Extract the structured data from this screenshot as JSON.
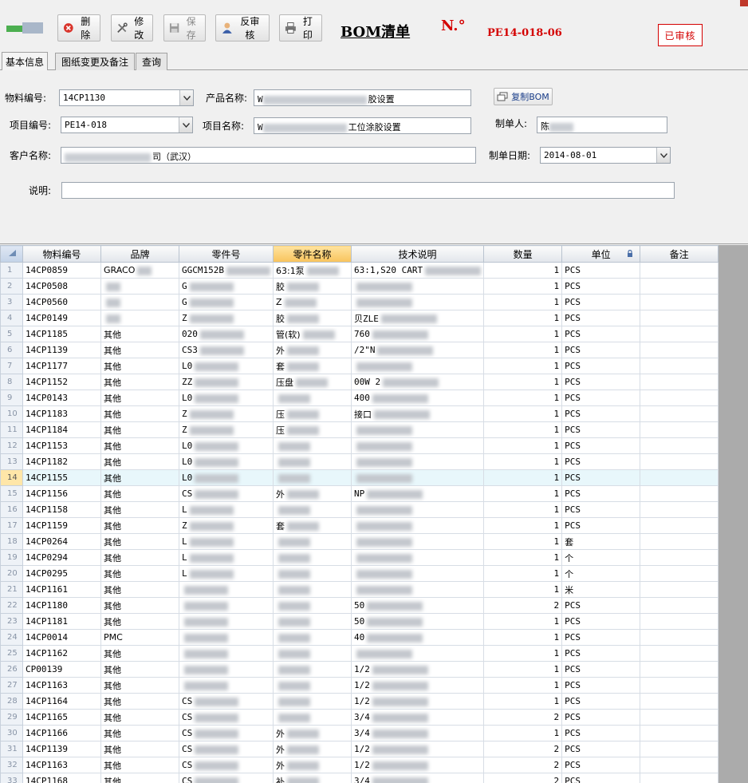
{
  "toolbar": {
    "delete_label": "删除",
    "edit_label": "修改",
    "save_label": "保存",
    "unaudit_label": "反审核",
    "print_label": "打印"
  },
  "header": {
    "title": "BOM清单",
    "no_label": "N.°",
    "no_value": "PE14-018-06",
    "stamp": "已审核"
  },
  "tabs": [
    "基本信息",
    "图纸变更及备注",
    "查询"
  ],
  "form": {
    "material_no_label": "物料编号:",
    "material_no_value": "14CP1130",
    "product_name_label": "产品名称:",
    "product_name_prefix": "W",
    "product_name_suffix": "胶设置",
    "copy_bom_label": "复制BOM",
    "project_no_label": "项目编号:",
    "project_no_value": "PE14-018",
    "project_name_label": "项目名称:",
    "project_name_prefix": "W",
    "project_name_suffix": "工位涂胶设置",
    "maker_label": "制单人:",
    "maker_value": "陈",
    "customer_label": "客户名称:",
    "customer_suffix": "司（武汉）",
    "date_label": "制单日期:",
    "date_value": "2014-08-01",
    "remark_label": "说明:"
  },
  "grid": {
    "columns": [
      "物料编号",
      "品牌",
      "零件号",
      "零件名称",
      "技术说明",
      "数量",
      "单位",
      "备注"
    ],
    "rows": [
      {
        "n": "1",
        "code": "14CP0859",
        "brand": "GRACO",
        "part": "GGCM152B",
        "name": "63:1泵",
        "tech": "63:1,S20 CART",
        "qty": "1",
        "unit": "PCS"
      },
      {
        "n": "2",
        "code": "14CP0508",
        "brand": "",
        "part": "G",
        "name": "胶",
        "tech": "",
        "qty": "1",
        "unit": "PCS"
      },
      {
        "n": "3",
        "code": "14CP0560",
        "brand": "",
        "part": "G",
        "name": "Z",
        "tech": "",
        "qty": "1",
        "unit": "PCS"
      },
      {
        "n": "4",
        "code": "14CP0149",
        "brand": "",
        "part": "Z",
        "name": "胶",
        "tech": "贝ZLE",
        "qty": "1",
        "unit": "PCS"
      },
      {
        "n": "5",
        "code": "14CP1185",
        "brand": "其他",
        "part": "020",
        "name": "管(软)",
        "tech": "760",
        "qty": "1",
        "unit": "PCS"
      },
      {
        "n": "6",
        "code": "14CP1139",
        "brand": "其他",
        "part": "CS3",
        "name": "外",
        "tech": "/2\"N",
        "qty": "1",
        "unit": "PCS"
      },
      {
        "n": "7",
        "code": "14CP1177",
        "brand": "其他",
        "part": "L0",
        "name": "套",
        "tech": "",
        "qty": "1",
        "unit": "PCS"
      },
      {
        "n": "8",
        "code": "14CP1152",
        "brand": "其他",
        "part": "ZZ",
        "name": "压盘",
        "tech": "00W 2",
        "qty": "1",
        "unit": "PCS"
      },
      {
        "n": "9",
        "code": "14CP0143",
        "brand": "其他",
        "part": "L0",
        "name": "",
        "tech": "400",
        "qty": "1",
        "unit": "PCS"
      },
      {
        "n": "10",
        "code": "14CP1183",
        "brand": "其他",
        "part": "Z",
        "name": "压",
        "tech": "接口",
        "qty": "1",
        "unit": "PCS"
      },
      {
        "n": "11",
        "code": "14CP1184",
        "brand": "其他",
        "part": "Z",
        "name": "压",
        "tech": "",
        "qty": "1",
        "unit": "PCS"
      },
      {
        "n": "12",
        "code": "14CP1153",
        "brand": "其他",
        "part": "L0",
        "name": "",
        "tech": "",
        "qty": "1",
        "unit": "PCS"
      },
      {
        "n": "13",
        "code": "14CP1182",
        "brand": "其他",
        "part": "L0",
        "name": "",
        "tech": "",
        "qty": "1",
        "unit": "PCS"
      },
      {
        "n": "14",
        "code": "14CP1155",
        "brand": "其他",
        "part": "L0",
        "name": "",
        "tech": "",
        "qty": "1",
        "unit": "PCS"
      },
      {
        "n": "15",
        "code": "14CP1156",
        "brand": "其他",
        "part": "CS",
        "name": "外",
        "tech": "NP",
        "qty": "1",
        "unit": "PCS"
      },
      {
        "n": "16",
        "code": "14CP1158",
        "brand": "其他",
        "part": "L",
        "name": "",
        "tech": "",
        "qty": "1",
        "unit": "PCS"
      },
      {
        "n": "17",
        "code": "14CP1159",
        "brand": "其他",
        "part": "Z",
        "name": "套",
        "tech": "",
        "qty": "1",
        "unit": "PCS"
      },
      {
        "n": "18",
        "code": "14CP0264",
        "brand": "其他",
        "part": "L",
        "name": "",
        "tech": "",
        "qty": "1",
        "unit": "套"
      },
      {
        "n": "19",
        "code": "14CP0294",
        "brand": "其他",
        "part": "L",
        "name": "",
        "tech": "",
        "qty": "1",
        "unit": "个"
      },
      {
        "n": "20",
        "code": "14CP0295",
        "brand": "其他",
        "part": "L",
        "name": "",
        "tech": "",
        "qty": "1",
        "unit": "个"
      },
      {
        "n": "21",
        "code": "14CP1161",
        "brand": "其他",
        "part": "",
        "name": "",
        "tech": "",
        "qty": "1",
        "unit": "米"
      },
      {
        "n": "22",
        "code": "14CP1180",
        "brand": "其他",
        "part": "",
        "name": "",
        "tech": "50",
        "qty": "2",
        "unit": "PCS"
      },
      {
        "n": "23",
        "code": "14CP1181",
        "brand": "其他",
        "part": "",
        "name": "",
        "tech": "50",
        "qty": "1",
        "unit": "PCS"
      },
      {
        "n": "24",
        "code": "14CP0014",
        "brand": "PMC",
        "part": "",
        "name": "",
        "tech": "40",
        "qty": "1",
        "unit": "PCS"
      },
      {
        "n": "25",
        "code": "14CP1162",
        "brand": "其他",
        "part": "",
        "name": "",
        "tech": "",
        "qty": "1",
        "unit": "PCS"
      },
      {
        "n": "26",
        "code": "CP00139",
        "brand": "其他",
        "part": "",
        "name": "",
        "tech": "1/2",
        "qty": "1",
        "unit": "PCS"
      },
      {
        "n": "27",
        "code": "14CP1163",
        "brand": "其他",
        "part": "",
        "name": "",
        "tech": "1/2",
        "qty": "1",
        "unit": "PCS"
      },
      {
        "n": "28",
        "code": "14CP1164",
        "brand": "其他",
        "part": "CS",
        "name": "",
        "tech": "1/2",
        "qty": "1",
        "unit": "PCS"
      },
      {
        "n": "29",
        "code": "14CP1165",
        "brand": "其他",
        "part": "CS",
        "name": "",
        "tech": "3/4",
        "qty": "2",
        "unit": "PCS"
      },
      {
        "n": "30",
        "code": "14CP1166",
        "brand": "其他",
        "part": "CS",
        "name": "外",
        "tech": "3/4",
        "qty": "1",
        "unit": "PCS"
      },
      {
        "n": "31",
        "code": "14CP1139",
        "brand": "其他",
        "part": "CS",
        "name": "外",
        "tech": "1/2",
        "qty": "2",
        "unit": "PCS"
      },
      {
        "n": "32",
        "code": "14CP1163",
        "brand": "其他",
        "part": "CS",
        "name": "外",
        "tech": "1/2",
        "qty": "2",
        "unit": "PCS"
      },
      {
        "n": "33",
        "code": "14CP1168",
        "brand": "其他",
        "part": "CS",
        "name": "补",
        "tech": "3/4",
        "qty": "2",
        "unit": "PCS"
      }
    ]
  },
  "colors": {
    "accent_red": "#d40000",
    "selected_row": "#e8f7fb",
    "sorted_header": "#f8c35c"
  }
}
